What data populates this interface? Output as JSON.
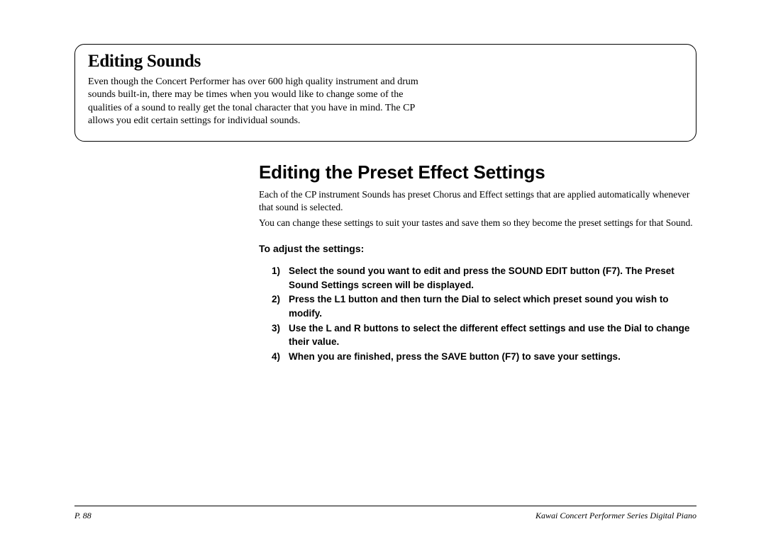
{
  "box": {
    "title": "Editing Sounds",
    "body": "Even though the Concert Performer has over 600 high quality instrument and drum sounds built-in, there may be times when  you would like to change some of the qualities of a sound to really get the tonal character that you have in mind.  The CP allows you edit certain settings for individual sounds."
  },
  "main": {
    "heading": "Editing the Preset Effect Settings",
    "para1": "Each of the CP instrument Sounds has preset Chorus and Effect settings that are applied automatically whenever that sound is selected.",
    "para2": "You can change these settings to suit your tastes and save them so they become the preset settings for that Sound.",
    "subheading": "To adjust the settings:",
    "steps": [
      {
        "num": "1)",
        "text": "Select the sound you want to edit and press the SOUND EDIT button (F7).  The Preset Sound Settings screen will be displayed."
      },
      {
        "num": "2)",
        "text": "Press the L1 button and then turn the Dial to select which preset sound you wish to modify."
      },
      {
        "num": "3)",
        "text": "Use the L and R buttons to select the different effect settings and use the Dial to change their value."
      },
      {
        "num": "4)",
        "text": "When you are finished, press the SAVE button (F7) to save your settings."
      }
    ]
  },
  "footer": {
    "left": "P. 88",
    "right": "Kawai Concert Performer Series Digital Piano"
  }
}
